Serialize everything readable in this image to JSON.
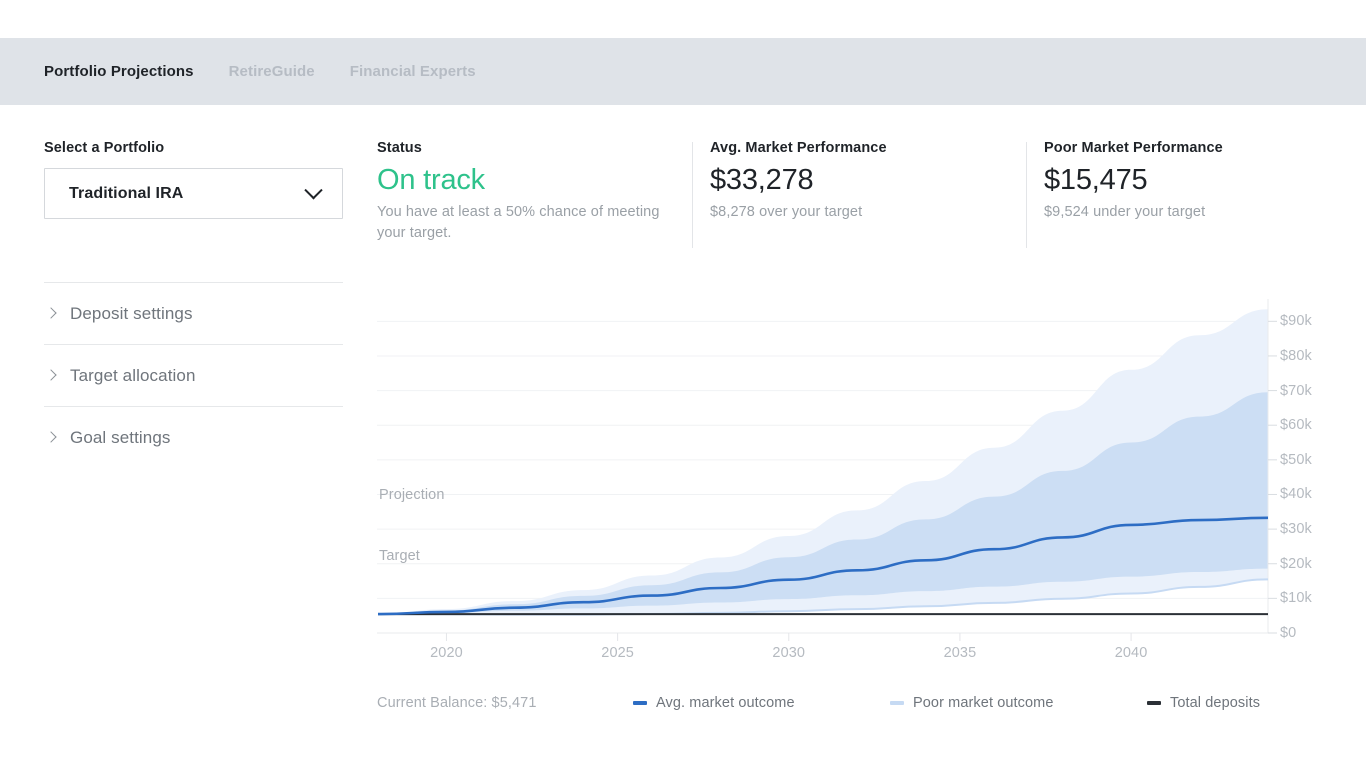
{
  "nav": {
    "items": [
      {
        "label": "Portfolio Projections",
        "active": true
      },
      {
        "label": "RetireGuide",
        "active": false
      },
      {
        "label": "Financial Experts",
        "active": false
      }
    ]
  },
  "sidebar": {
    "title": "Select a Portfolio",
    "portfolio_selected": "Traditional IRA",
    "chevron_icon": "chevron-down-icon",
    "sections": [
      {
        "label": "Deposit settings",
        "icon": "chevron-right-icon"
      },
      {
        "label": "Target allocation",
        "icon": "chevron-right-icon"
      },
      {
        "label": "Goal settings",
        "icon": "chevron-right-icon"
      }
    ]
  },
  "stats": {
    "status": {
      "label": "Status",
      "value": "On track",
      "sub": "You have at least a 50% chance of meeting your target.",
      "color": "#2ec28b"
    },
    "avg": {
      "label": "Avg. Market Performance",
      "value": "$33,278",
      "sub": "$8,278 over your target"
    },
    "poor": {
      "label": "Poor Market Performance",
      "value": "$15,475",
      "sub": "$9,524 under your target"
    }
  },
  "chart_annotations": {
    "projection": "Projection",
    "target": "Target"
  },
  "legend": {
    "balance": "Current Balance: $5,471",
    "items": [
      {
        "label": "Avg. market outcome",
        "color": "#2d6dc4"
      },
      {
        "label": "Poor market outcome",
        "color": "#c6daf3"
      },
      {
        "label": "Total deposits",
        "color": "#2b3036"
      }
    ]
  },
  "chart_data": {
    "type": "area",
    "title": "",
    "xlabel": "",
    "ylabel": "",
    "xlim": [
      2018,
      2044
    ],
    "ylim": [
      0,
      95000
    ],
    "grid": true,
    "legend_position": "bottom",
    "yticks": [
      0,
      10000,
      20000,
      30000,
      40000,
      50000,
      60000,
      70000,
      80000,
      90000
    ],
    "ytick_labels": [
      "$0",
      "$10k",
      "$20k",
      "$30k",
      "$40k",
      "$50k",
      "$60k",
      "$70k",
      "$80k",
      "$90k"
    ],
    "xticks": [
      2020,
      2025,
      2030,
      2035,
      2040
    ],
    "xtick_labels": [
      "2020",
      "2025",
      "2030",
      "2035",
      "2040"
    ],
    "x": [
      2018,
      2020,
      2022,
      2024,
      2026,
      2028,
      2030,
      2032,
      2034,
      2036,
      2038,
      2040,
      2042,
      2044
    ],
    "series": [
      {
        "name": "Upper outer band",
        "type": "band_upper_outer",
        "color": "#eaf1fb",
        "values": [
          5471,
          6900,
          9200,
          12400,
          16600,
          21800,
          28000,
          35400,
          43900,
          53500,
          64200,
          76000,
          86000,
          93500
        ]
      },
      {
        "name": "Upper inner band",
        "type": "band_upper_inner",
        "color": "#ccdef4",
        "values": [
          5471,
          6500,
          8300,
          10700,
          13800,
          17500,
          21900,
          27000,
          32800,
          39400,
          46800,
          55000,
          62500,
          69500
        ]
      },
      {
        "name": "Avg. market outcome",
        "type": "line",
        "color": "#2d6dc4",
        "values": [
          5471,
          6100,
          7300,
          8900,
          10800,
          13000,
          15400,
          18100,
          21000,
          24200,
          27600,
          31200,
          32600,
          33278
        ]
      },
      {
        "name": "Lower inner band",
        "type": "band_lower_inner",
        "color": "#ccdef4",
        "values": [
          5471,
          5800,
          6400,
          7100,
          7900,
          8800,
          9800,
          10900,
          12100,
          13400,
          14800,
          16300,
          17600,
          18600
        ]
      },
      {
        "name": "Poor market outcome",
        "type": "line",
        "color": "#c6daf3",
        "values": [
          5471,
          5400,
          5300,
          5300,
          5500,
          5800,
          6300,
          6900,
          7700,
          8700,
          9900,
          11400,
          13300,
          15475
        ]
      },
      {
        "name": "Total deposits",
        "type": "line",
        "color": "#2b3036",
        "values": [
          5471,
          5471,
          5471,
          5471,
          5471,
          5471,
          5471,
          5471,
          5471,
          5471,
          5471,
          5471,
          5471,
          5471
        ]
      }
    ]
  }
}
